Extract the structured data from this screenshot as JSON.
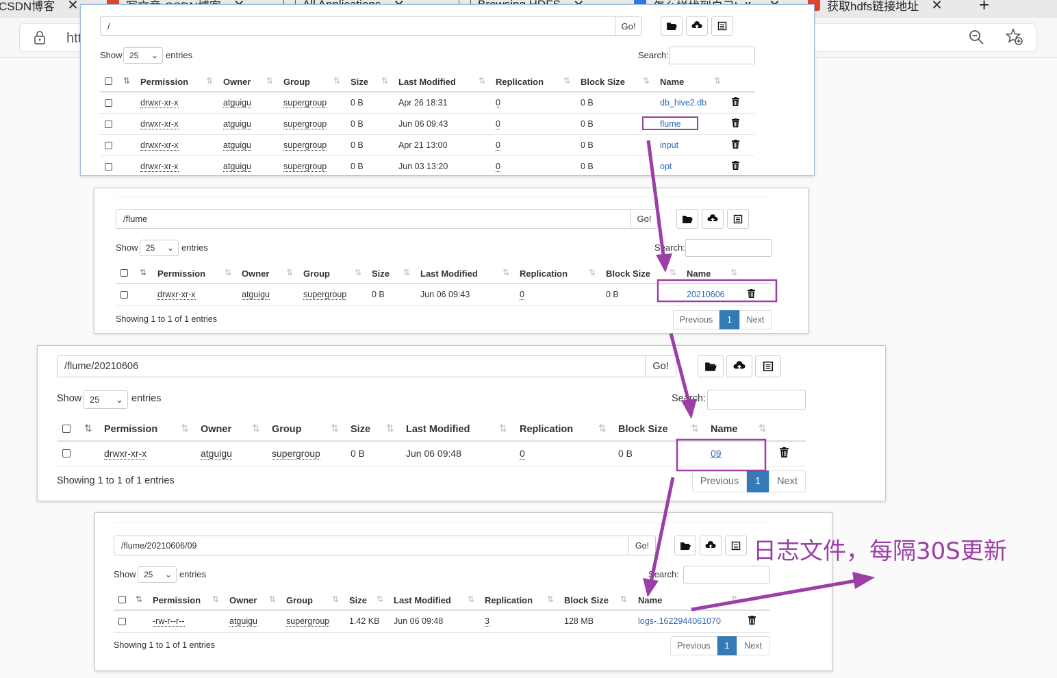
{
  "browser": {
    "tabs": [
      {
        "title": "CSDN博客"
      },
      {
        "title": "写文章-CSDN博客"
      },
      {
        "title": "All Applications"
      },
      {
        "title": "Browsing HDFS"
      },
      {
        "title": "怎么样找到自己hdfs"
      },
      {
        "title": "获取hdfs链接地址"
      }
    ],
    "url": "htt"
  },
  "panels": [
    {
      "path": "/",
      "go": "Go!",
      "show": "Show",
      "entries_count": "25",
      "entries": "entries",
      "search": "Search:",
      "headers": [
        "Permission",
        "Owner",
        "Group",
        "Size",
        "Last Modified",
        "Replication",
        "Block Size",
        "Name"
      ],
      "rows": [
        {
          "permission": "drwxr-xr-x",
          "owner": "atguigu",
          "group": "supergroup",
          "size": "0 B",
          "modified": "Apr 26 18:31",
          "replication": "0",
          "block": "0 B",
          "name": "db_hive2.db"
        },
        {
          "permission": "drwxr-xr-x",
          "owner": "atguigu",
          "group": "supergroup",
          "size": "0 B",
          "modified": "Jun 06 09:43",
          "replication": "0",
          "block": "0 B",
          "name": "flume"
        },
        {
          "permission": "drwxr-xr-x",
          "owner": "atguigu",
          "group": "supergroup",
          "size": "0 B",
          "modified": "Apr 21 13:00",
          "replication": "0",
          "block": "0 B",
          "name": "input"
        },
        {
          "permission": "drwxr-xr-x",
          "owner": "atguigu",
          "group": "supergroup",
          "size": "0 B",
          "modified": "Jun 03 13:20",
          "replication": "0",
          "block": "0 B",
          "name": "opt"
        }
      ]
    },
    {
      "path": "/flume",
      "go": "Go!",
      "show": "Show",
      "entries_count": "25",
      "entries": "entries",
      "search": "Search:",
      "headers": [
        "Permission",
        "Owner",
        "Group",
        "Size",
        "Last Modified",
        "Replication",
        "Block Size",
        "Name"
      ],
      "rows": [
        {
          "permission": "drwxr-xr-x",
          "owner": "atguigu",
          "group": "supergroup",
          "size": "0 B",
          "modified": "Jun 06 09:43",
          "replication": "0",
          "block": "0 B",
          "name": "20210606"
        }
      ],
      "footer": "Showing 1 to 1 of 1 entries",
      "pager": {
        "prev": "Previous",
        "page": "1",
        "next": "Next"
      }
    },
    {
      "path": "/flume/20210606",
      "go": "Go!",
      "show": "Show",
      "entries_count": "25",
      "entries": "entries",
      "search": "Search:",
      "headers": [
        "Permission",
        "Owner",
        "Group",
        "Size",
        "Last Modified",
        "Replication",
        "Block Size",
        "Name"
      ],
      "rows": [
        {
          "permission": "drwxr-xr-x",
          "owner": "atguigu",
          "group": "supergroup",
          "size": "0 B",
          "modified": "Jun 06 09:48",
          "replication": "0",
          "block": "0 B",
          "name": "09"
        }
      ],
      "footer": "Showing 1 to 1 of 1 entries",
      "pager": {
        "prev": "Previous",
        "page": "1",
        "next": "Next"
      }
    },
    {
      "path": "/flume/20210606/09",
      "go": "Go!",
      "show": "Show",
      "entries_count": "25",
      "entries": "entries",
      "search": "Search:",
      "headers": [
        "Permission",
        "Owner",
        "Group",
        "Size",
        "Last Modified",
        "Replication",
        "Block Size",
        "Name"
      ],
      "rows": [
        {
          "permission": "-rw-r--r--",
          "owner": "atguigu",
          "group": "supergroup",
          "size": "1.42 KB",
          "modified": "Jun 06 09:48",
          "replication": "3",
          "block": "128 MB",
          "name": "logs-.1622944061070"
        }
      ],
      "footer": "Showing 1 to 1 of 1 entries",
      "pager": {
        "prev": "Previous",
        "page": "1",
        "next": "Next"
      }
    }
  ],
  "annotation": {
    "text": "日志文件，每隔30S更新",
    "color": "#9b3fa7"
  },
  "colors": {
    "link": "#2a6ab8",
    "accent": "#337ab7",
    "highlight": "#9b3fa7"
  }
}
